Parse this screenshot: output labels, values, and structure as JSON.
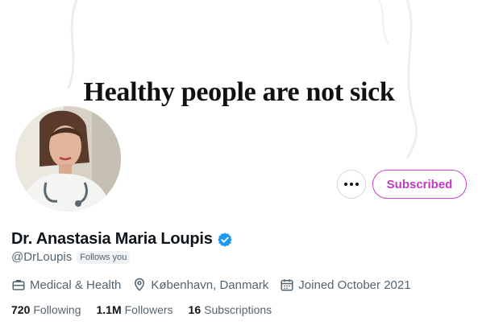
{
  "banner": {
    "text": "Healthy people are not sick"
  },
  "profile": {
    "display_name": "Dr. Anastasia Maria Loupis",
    "handle": "@DrLoupis",
    "follows_you": "Follows you"
  },
  "actions": {
    "subscribed_label": "Subscribed"
  },
  "meta": {
    "category": "Medical & Health",
    "location": "København, Danmark",
    "joined": "Joined October 2021"
  },
  "stats": {
    "following_count": "720",
    "following_label": "Following",
    "followers_count": "1.1M",
    "followers_label": "Followers",
    "subscriptions_count": "16",
    "subscriptions_label": "Subscriptions"
  },
  "colors": {
    "accent": "#c13ac1",
    "verified": "#1d9bf0",
    "secondary_text": "#536471"
  },
  "icons": [
    "more-icon",
    "verified-icon",
    "briefcase-icon",
    "location-pin-icon",
    "calendar-icon"
  ]
}
